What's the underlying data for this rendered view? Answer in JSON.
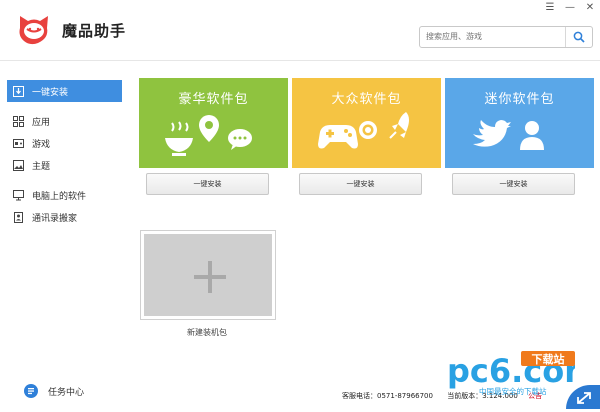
{
  "app": {
    "title": "魔品助手"
  },
  "search": {
    "placeholder": "搜索应用、游戏"
  },
  "sidebar": {
    "items": [
      {
        "label": "一键安装",
        "icon": "download-box-icon",
        "active": true
      },
      {
        "label": "应用",
        "icon": "grid-icon"
      },
      {
        "label": "游戏",
        "icon": "gamepad-icon"
      },
      {
        "label": "主题",
        "icon": "image-icon"
      },
      {
        "label": "电脑上的软件",
        "icon": "monitor-icon"
      },
      {
        "label": "通讯录搬家",
        "icon": "contacts-icon"
      }
    ]
  },
  "packages": [
    {
      "title": "豪华软件包",
      "button": "一键安装",
      "color": "#8fc33f"
    },
    {
      "title": "大众软件包",
      "button": "一键安装",
      "color": "#f5c443"
    },
    {
      "title": "迷你软件包",
      "button": "一键安装",
      "color": "#5aa7e8"
    }
  ],
  "new_package": {
    "label": "新建装机包"
  },
  "footer": {
    "task_center": "任务中心",
    "hotline_label": "客服电话：0571-87966700",
    "version_label": "当前版本：3.124.000",
    "notice": "公告"
  },
  "watermark": {
    "brand": "pc6.com",
    "badge": "下载站",
    "slogan": "中国最安全的下载站"
  }
}
